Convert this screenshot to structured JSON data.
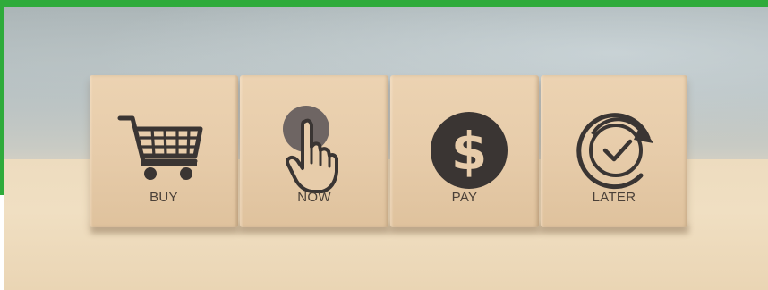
{
  "image": {
    "kind": "photo",
    "blocks": [
      {
        "label": "BUY",
        "icon": "shopping-cart-icon"
      },
      {
        "label": "NOW",
        "icon": "pointing-hand-icon"
      },
      {
        "label": "PAY",
        "icon": "dollar-icon"
      },
      {
        "label": "LATER",
        "icon": "clock-refresh-icon"
      }
    ]
  },
  "colors": {
    "accent_border": "#2fab3b",
    "icon_dark": "#3a3533",
    "wood": "#e7ccaa"
  }
}
